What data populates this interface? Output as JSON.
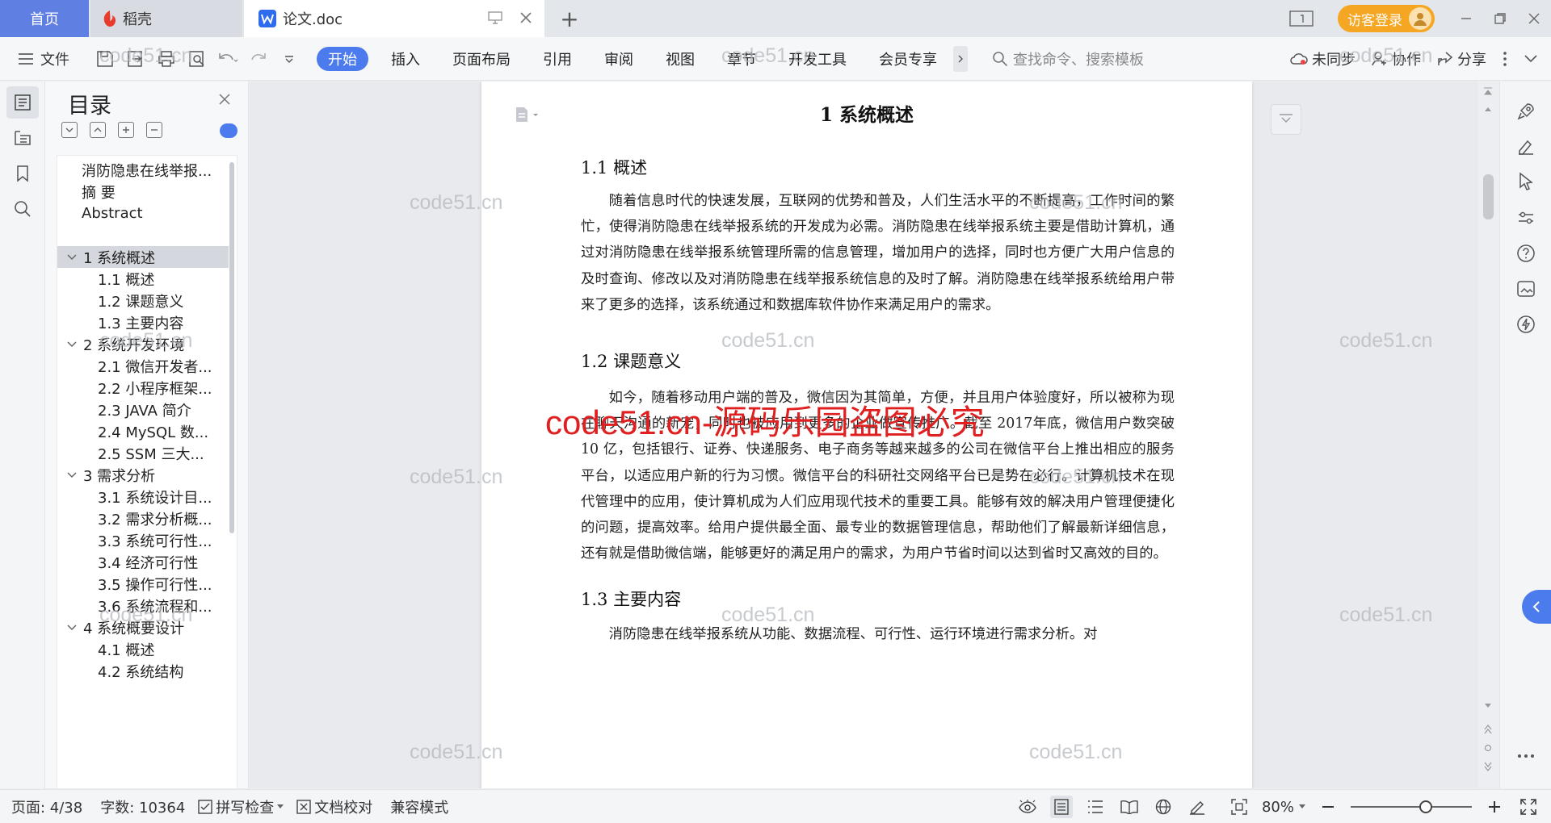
{
  "tabs": {
    "home": "首页",
    "daoke": "稻壳",
    "doc": "论文.doc"
  },
  "login": "访客登录",
  "ribbon": {
    "file": "文件",
    "tabs": [
      "开始",
      "插入",
      "页面布局",
      "引用",
      "审阅",
      "视图",
      "章节",
      "开发工具",
      "会员专享"
    ],
    "search_placeholder": "查找命令、搜索模板",
    "sync": "未同步",
    "collab": "协作",
    "share": "分享"
  },
  "toc": {
    "title": "目录",
    "items": [
      {
        "label": "消防隐患在线举报...",
        "level": 0
      },
      {
        "label": "摘  要",
        "level": 0
      },
      {
        "label": "Abstract",
        "level": 0
      },
      {
        "label": "",
        "level": 0
      },
      {
        "label": "1  系统概述",
        "level": 1,
        "expanded": true,
        "selected": true
      },
      {
        "label": "1.1  概述",
        "level": 2
      },
      {
        "label": "1.2 课题意义",
        "level": 2
      },
      {
        "label": "1.3  主要内容",
        "level": 2
      },
      {
        "label": "2  系统开发环境",
        "level": 1,
        "expanded": true
      },
      {
        "label": "2.1 微信开发者...",
        "level": 2
      },
      {
        "label": "2.2 小程序框架...",
        "level": 2
      },
      {
        "label": "2.3 JAVA 简介",
        "level": 2
      },
      {
        "label": "2.4 MySQL 数...",
        "level": 2
      },
      {
        "label": "2.5 SSM 三大...",
        "level": 2
      },
      {
        "label": "3  需求分析",
        "level": 1,
        "expanded": true
      },
      {
        "label": "3.1  系统设计目...",
        "level": 2
      },
      {
        "label": "3.2 需求分析概...",
        "level": 2
      },
      {
        "label": "3.3  系统可行性...",
        "level": 2
      },
      {
        "label": "3.4 经济可行性",
        "level": 2
      },
      {
        "label": "3.5 操作可行性...",
        "level": 2
      },
      {
        "label": "3.6 系统流程和...",
        "level": 2
      },
      {
        "label": "4 系统概要设计",
        "level": 1,
        "expanded": true
      },
      {
        "label": "4.1  概述",
        "level": 2
      },
      {
        "label": "4.2  系统结构",
        "level": 2
      }
    ]
  },
  "document": {
    "h1": "1  系统概述",
    "s1_title": "1.1  概述",
    "s1_body": "随着信息时代的快速发展，互联网的优势和普及，人们生活水平的不断提高，工作时间的繁忙，使得消防隐患在线举报系统的开发成为必需。消防隐患在线举报系统主要是借助计算机，通过对消防隐患在线举报系统管理所需的信息管理，增加用户的选择，同时也方便广大用户信息的及时查询、修改以及对消防隐患在线举报系统信息的及时了解。消防隐患在线举报系统给用户带来了更多的选择，该系统通过和数据库软件协作来满足用户的需求。",
    "s2_title": "1.2 课题意义",
    "s2_body": "如今，随着移动用户端的普及，微信因为其简单，方便，并且用户体验度好，所以被称为现在聊天沟通的新宠，同时也被应用到更多的企业做宣传推广。截至 2017年底，微信用户数突破 10 亿，包括银行、证券、快递服务、电子商务等越来越多的公司在微信平台上推出相应的服务平台，以适应用户新的行为习惯。微信平台的科研社交网络平台已是势在必行。计算机技术在现代管理中的应用，使计算机成为人们应用现代技术的重要工具。能够有效的解决用户管理便捷化的问题，提高效率。给用户提供最全面、最专业的数据管理信息，帮助他们了解最新详细信息，还有就是借助微信端，能够更好的满足用户的需求，为用户节省时间以达到省时又高效的目的。",
    "s3_title": "1.3  主要内容",
    "s3_body": "消防隐患在线举报系统从功能、数据流程、可行性、运行环境进行需求分析。对"
  },
  "watermark": {
    "text": "code51.cn",
    "red": "code51.cn-源码乐园盗图必究"
  },
  "status": {
    "page": "页面: 4/38",
    "words": "字数: 10364",
    "spell": "拼写检查",
    "proof": "文档校对",
    "compat": "兼容模式",
    "zoom": "80%",
    "zoom_level": 0.62
  },
  "colors": {
    "accent": "#4b7bec",
    "home_tab": "#5f7fe3",
    "login": "#f5a623",
    "watermark_red": "#e02020"
  }
}
